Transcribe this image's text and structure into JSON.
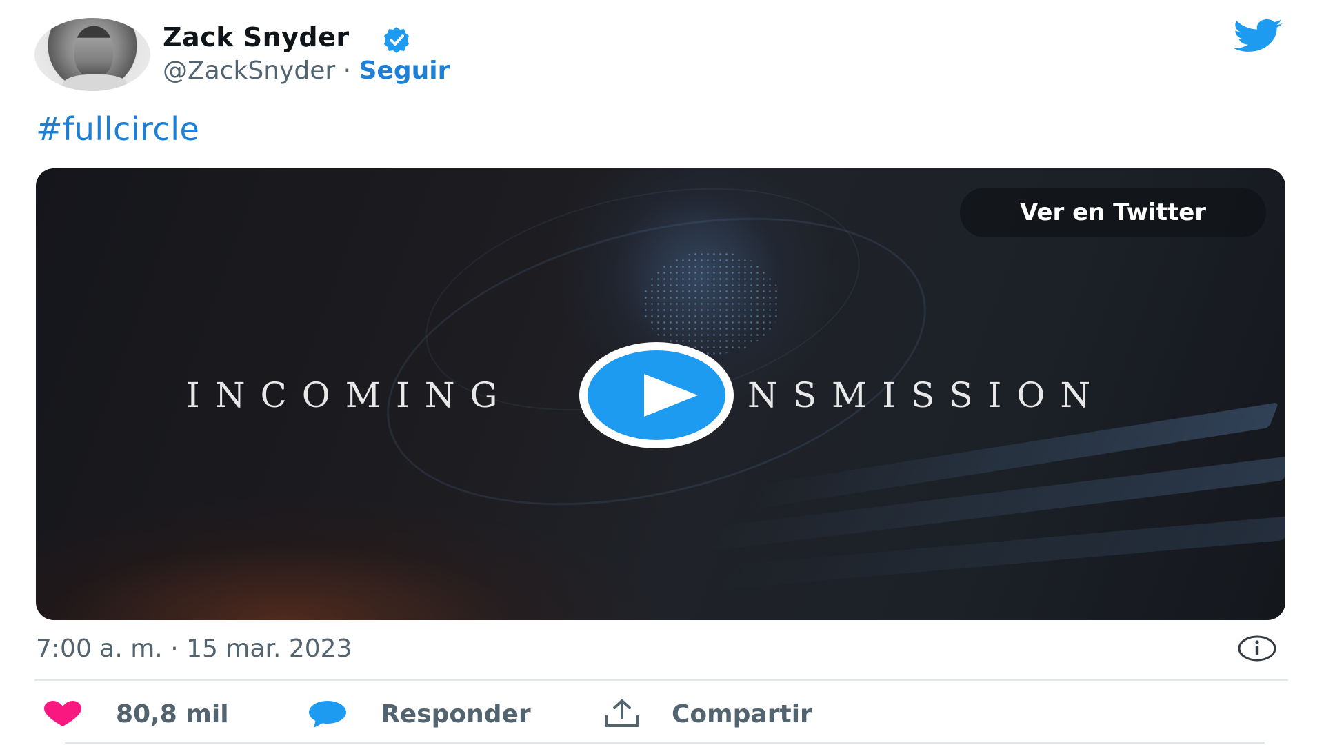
{
  "author": {
    "name": "Zack Snyder",
    "handle": "@ZackSnyder",
    "separator": "·",
    "follow_label": "Seguir",
    "verified": true
  },
  "tweet": {
    "text": "#fullcircle"
  },
  "video": {
    "view_on_label": "Ver en Twitter",
    "title_left": "INCOMING",
    "title_right": "NSMISSION",
    "play_icon": "play-icon"
  },
  "meta": {
    "timestamp": "7:00 a. m. · 15 mar. 2023",
    "info_icon": "info-icon"
  },
  "actions": {
    "like_count": "80,8 mil",
    "reply_label": "Responder",
    "share_label": "Compartir"
  },
  "colors": {
    "accent": "#1d9bf0",
    "link": "#1d80d6",
    "like": "#f91880",
    "secondary_text": "#536471"
  }
}
